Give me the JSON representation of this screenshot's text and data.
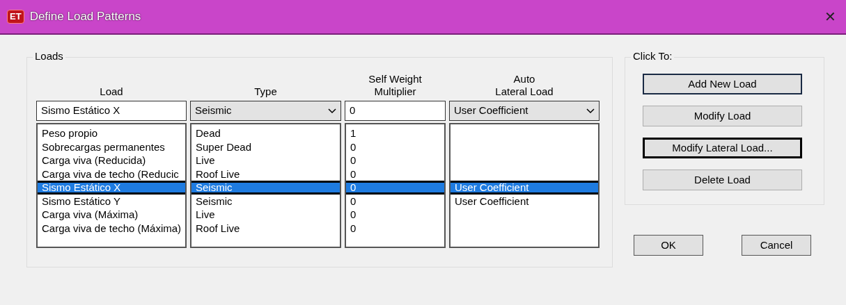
{
  "window": {
    "icon_text": "ET",
    "title": "Define Load Patterns",
    "close": "✕"
  },
  "loads": {
    "legend": "Loads",
    "columns": [
      {
        "label": "Load"
      },
      {
        "label": "Type"
      },
      {
        "label": "Self Weight Multiplier"
      },
      {
        "label": "Auto Lateral Load"
      }
    ],
    "editor": {
      "load": "Sismo Estático X",
      "type": "Seismic",
      "multiplier": "0",
      "lateral": "User Coefficient"
    },
    "rows": [
      {
        "load": "Peso propio",
        "type": "Dead",
        "multiplier": "1",
        "selected": false
      },
      {
        "load": "Sobrecargas permanentes",
        "type": "Super Dead",
        "multiplier": "0",
        "selected": false
      },
      {
        "load": "Carga viva (Reducida)",
        "type": "Live",
        "multiplier": "0",
        "selected": false
      },
      {
        "load": "Carga viva de techo (Reducic",
        "type": "Roof Live",
        "multiplier": "0",
        "selected": false
      },
      {
        "load": "Sismo Estático X",
        "type": "Seismic",
        "multiplier": "0",
        "lateral": "User Coefficient",
        "selected": true
      },
      {
        "load": "Sismo Estático Y",
        "type": "Seismic",
        "multiplier": "0",
        "lateral": "User Coefficient",
        "selected": false
      },
      {
        "load": "Carga viva (Máxima)",
        "type": "Live",
        "multiplier": "0",
        "selected": false
      },
      {
        "load": "Carga viva de techo (Máxima)",
        "type": "Roof Live",
        "multiplier": "0",
        "selected": false
      }
    ]
  },
  "click_to": {
    "legend": "Click To:",
    "buttons": [
      {
        "label": "Add New Load",
        "default": true,
        "focused": false
      },
      {
        "label": "Modify Load",
        "default": false,
        "focused": false
      },
      {
        "label": "Modify Lateral Load...",
        "default": false,
        "focused": true
      },
      {
        "label": "Delete Load",
        "default": false,
        "focused": false
      }
    ]
  },
  "buttons": [
    {
      "label": "OK"
    },
    {
      "label": "Cancel"
    }
  ]
}
